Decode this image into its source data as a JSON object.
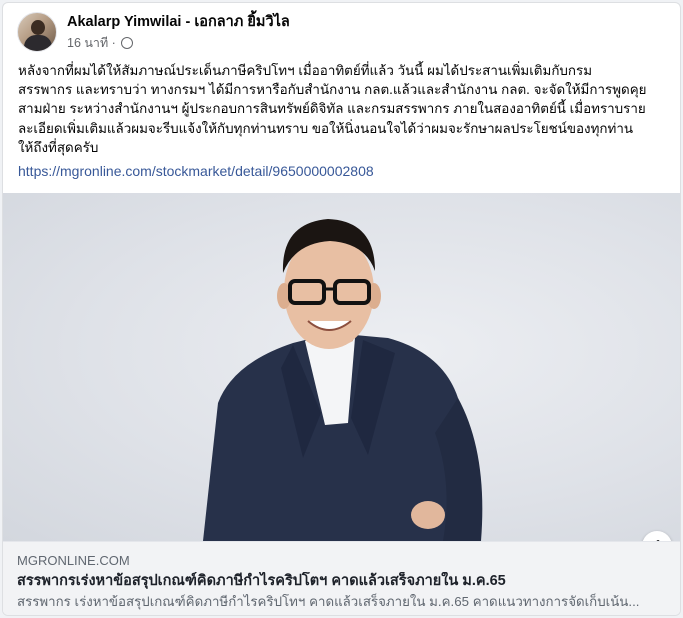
{
  "post": {
    "author": "Akalarp Yimwilai - เอกลาภ ยิ้มวิไล",
    "time": "16 นาที ·",
    "text": "หลังจากที่ผมได้ให้สัมภาษณ์ประเด็นภาษีคริปโทฯ เมื่ออาทิตย์ที่แล้ว วันนี้ ผมได้ประสานเพิ่มเติมกับกรม\nสรรพากร และทราบว่า ทางกรมฯ ได้มีการหารือกับสำนักงาน กลต.แล้วและสำนักงาน กลต. จะจัดให้มีการพูดคุย\nสามฝ่าย ระหว่างสำนักงานฯ ผู้ประกอบการสินทรัพย์ดิจิทัล และกรมสรรพากร ภายในสองอาทิตย์นี้  เมื่อทราบราย\nละเอียดเพิ่มเติมแล้วผมจะรีบแจ้งให้กับทุกท่านทราบ ขอให้นิ่งนอนใจได้ว่าผมจะรักษาผลประโยชน์ของทุกท่าน\nให้ถึงที่สุดครับ",
    "link": "https://mgronline.com/stockmarket/detail/9650000002808"
  },
  "preview": {
    "info_label": "i",
    "domain": "MGRONLINE.COM",
    "headline": "สรรพากรเร่งหาข้อสรุปเกณฑ์คิดภาษีกำไรคริปโตฯ คาดแล้วเสร็จภายใน ม.ค.65",
    "description": "สรรพากร เร่งหาข้อสรุปเกณฑ์คิดภาษีกำไรคริปโทฯ คาดแล้วเสร็จภายใน ม.ค.65 คาดแนวทางการจัดเก็บเน้น..."
  },
  "colors": {
    "link": "#385898",
    "meta_text": "#65676b",
    "preview_bg": "#f2f3f5",
    "suit": "#27314a",
    "shirt": "#f4f5f7"
  }
}
